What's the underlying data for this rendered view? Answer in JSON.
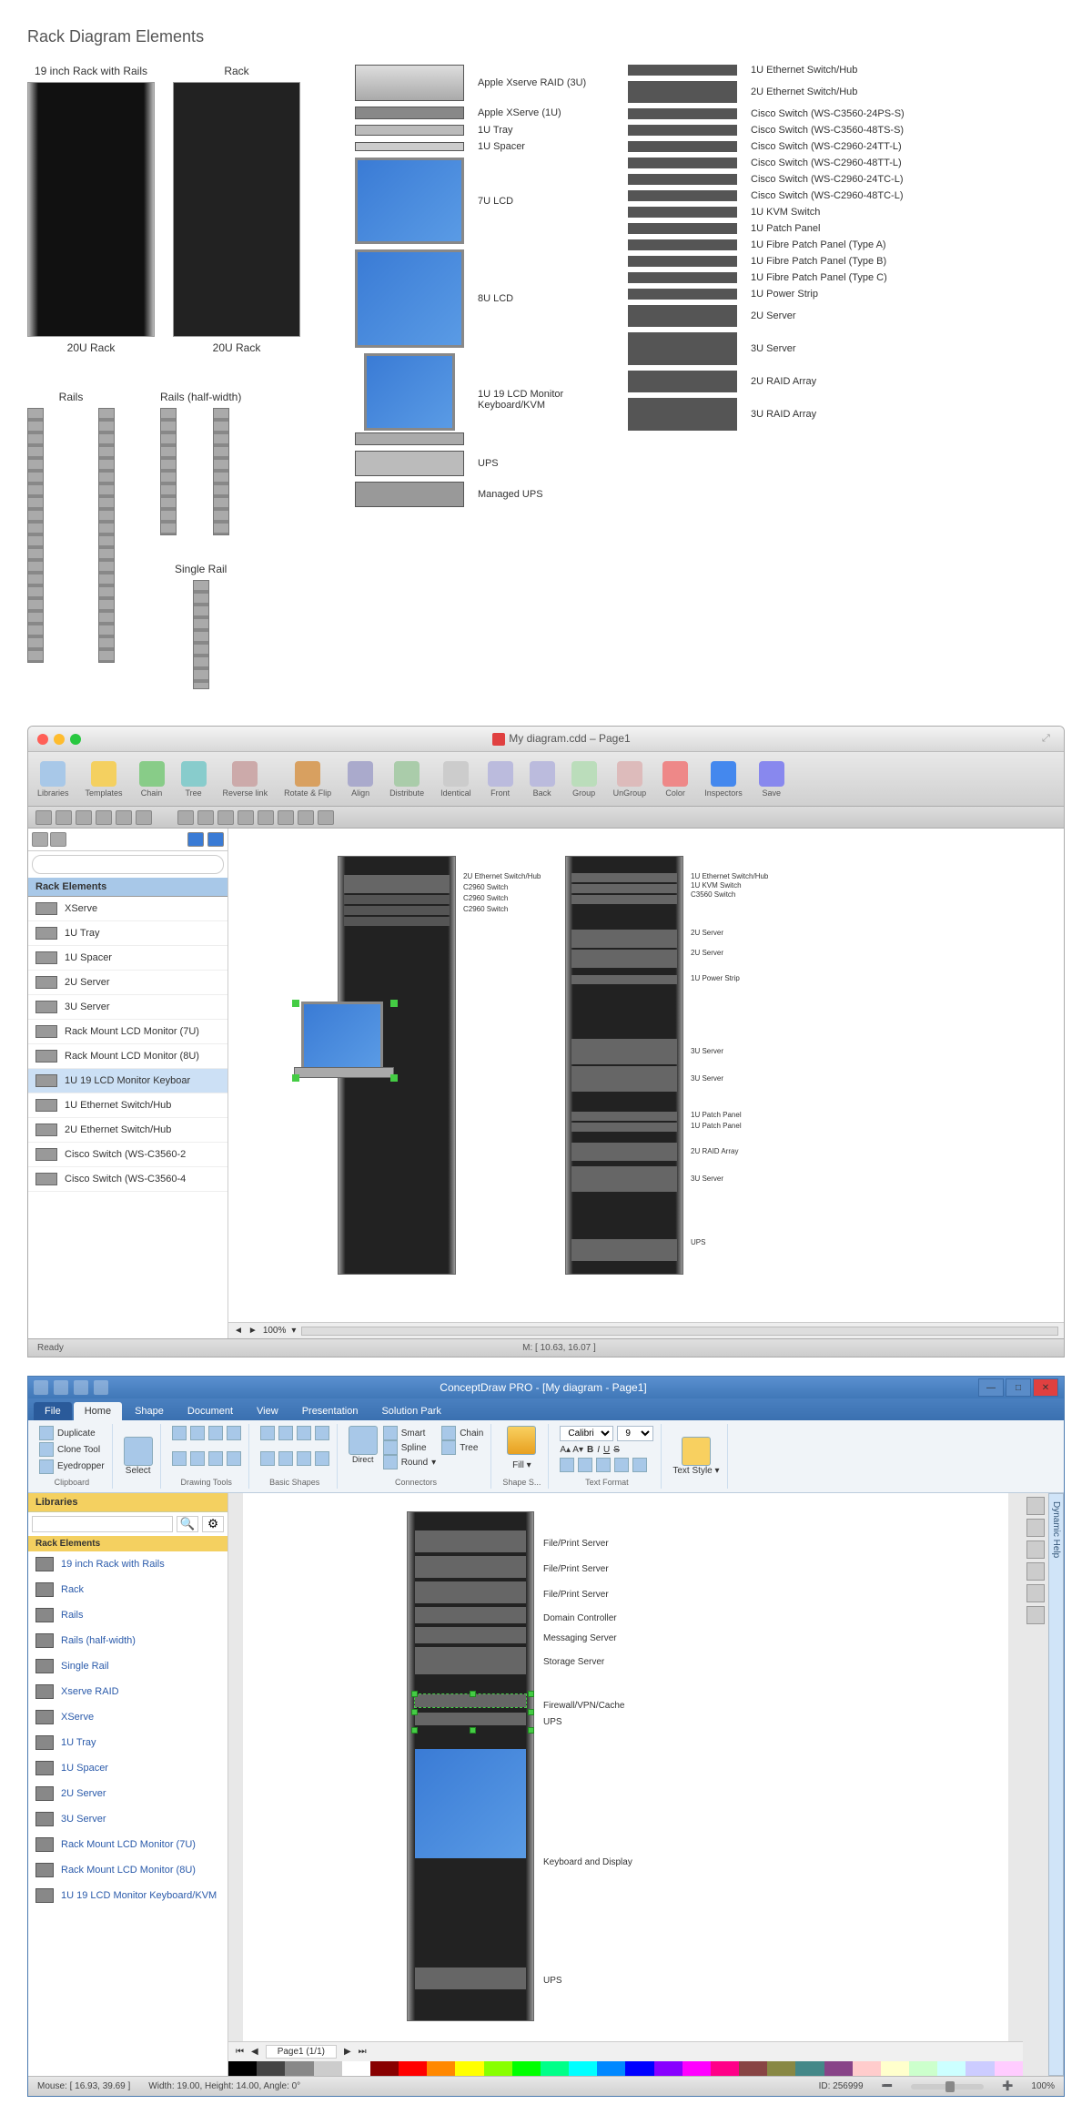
{
  "top": {
    "title": "Rack Diagram Elements",
    "rack1_label": "19 inch Rack with Rails",
    "rack1_sub": "20U Rack",
    "rack2_label": "Rack",
    "rack2_sub": "20U Rack",
    "rails_label": "Rails",
    "rails_half_label": "Rails (half-width)",
    "single_rail_label": "Single Rail",
    "col3": [
      "Apple Xserve RAID (3U)",
      "Apple XServe (1U)",
      "1U Tray",
      "1U Spacer",
      "7U LCD",
      "8U LCD",
      "1U 19 LCD Monitor Keyboard/KVM",
      "UPS",
      "Managed UPS"
    ],
    "col4": [
      "1U Ethernet Switch/Hub",
      "2U Ethernet Switch/Hub",
      "Cisco Switch (WS-C3560-24PS-S)",
      "Cisco Switch (WS-C3560-48TS-S)",
      "Cisco Switch (WS-C2960-24TT-L)",
      "Cisco Switch (WS-C2960-48TT-L)",
      "Cisco Switch (WS-C2960-24TC-L)",
      "Cisco Switch (WS-C2960-48TC-L)",
      "1U KVM Switch",
      "1U Patch Panel",
      "1U Fibre Patch Panel (Type A)",
      "1U Fibre Patch Panel (Type B)",
      "1U Fibre Patch Panel (Type C)",
      "1U Power Strip",
      "2U Server",
      "3U Server",
      "2U RAID Array",
      "3U RAID Array"
    ]
  },
  "mac": {
    "title": "My diagram.cdd – Page1",
    "toolbar": [
      "Libraries",
      "Templates",
      "Chain",
      "Tree",
      "Reverse link",
      "Rotate & Flip",
      "Align",
      "Distribute",
      "Identical",
      "Front",
      "Back",
      "Group",
      "UnGroup",
      "Color",
      "Inspectors",
      "Save"
    ],
    "sidebar_title": "Rack Elements",
    "sidebar_items": [
      {
        "label": "XServe",
        "sel": false
      },
      {
        "label": "1U Tray",
        "sel": false
      },
      {
        "label": "1U Spacer",
        "sel": false
      },
      {
        "label": "2U Server",
        "sel": false
      },
      {
        "label": "3U Server",
        "sel": false
      },
      {
        "label": "Rack Mount LCD Monitor (7U)",
        "sel": false
      },
      {
        "label": "Rack Mount LCD Monitor (8U)",
        "sel": false
      },
      {
        "label": "1U 19 LCD Monitor Keyboar",
        "sel": true
      },
      {
        "label": "1U Ethernet Switch/Hub",
        "sel": false
      },
      {
        "label": "2U Ethernet Switch/Hub",
        "sel": false
      },
      {
        "label": "Cisco Switch (WS-C3560-2",
        "sel": false
      },
      {
        "label": "Cisco Switch (WS-C3560-4",
        "sel": false
      }
    ],
    "zoom": "100%",
    "status_m": "M: [ 10.63, 16.07 ]",
    "status_ready": "Ready",
    "left_rack_labels": [
      "2U Ethernet Switch/Hub",
      "C2960 Switch",
      "C2960 Switch",
      "C2960 Switch"
    ],
    "right_rack_labels": [
      "1U Ethernet Switch/Hub",
      "1U KVM Switch",
      "C3560 Switch",
      "2U Server",
      "2U Server",
      "1U Power Strip",
      "3U Server",
      "3U Server",
      "1U Patch Panel",
      "1U Patch Panel",
      "2U RAID Array",
      "3U Server",
      "UPS"
    ]
  },
  "win": {
    "title": "ConceptDraw PRO - [My diagram - Page1]",
    "tabs": [
      "File",
      "Home",
      "Shape",
      "Document",
      "View",
      "Presentation",
      "Solution Park"
    ],
    "active_tab": "Home",
    "clipboard": {
      "dup": "Duplicate",
      "clone": "Clone Tool",
      "eye": "Eyedropper",
      "label": "Clipboard"
    },
    "drawing_label": "Drawing Tools",
    "shapes_label": "Basic Shapes",
    "connectors": {
      "direct": "Direct",
      "smart": "Smart",
      "spline": "Spline",
      "round": "Round",
      "label": "Connectors"
    },
    "chain": "Chain",
    "tree": "Tree",
    "fill": "Fill",
    "shape_s": "Shape S...",
    "font_name": "Calibri",
    "font_size": "9",
    "text_format": "Text Format",
    "select": "Select",
    "text_style": "Text Style",
    "lib_header": "Libraries",
    "lib_cat": "Rack Elements",
    "lib_items": [
      "19 inch Rack with Rails",
      "Rack",
      "Rails",
      "Rails (half-width)",
      "Single Rail",
      "Xserve RAID",
      "XServe",
      "1U Tray",
      "1U Spacer",
      "2U Server",
      "3U Server",
      "Rack Mount LCD Monitor (7U)",
      "Rack Mount LCD Monitor (8U)",
      "1U 19 LCD Monitor Keyboard/KVM"
    ],
    "canvas_labels": [
      "File/Print Server",
      "File/Print Server",
      "File/Print Server",
      "Domain Controller",
      "Messaging Server",
      "Storage Server",
      "Firewall/VPN/Cache",
      "UPS",
      "Keyboard and Display",
      "UPS"
    ],
    "page_label": "Page1 (1/1)",
    "dynamic_help": "Dynamic Help",
    "status": {
      "mouse": "Mouse: [ 16.93, 39.69 ]",
      "dims": "Width: 19.00,  Height: 14.00,  Angle: 0°",
      "id": "ID: 256999",
      "zoom": "100%"
    }
  }
}
